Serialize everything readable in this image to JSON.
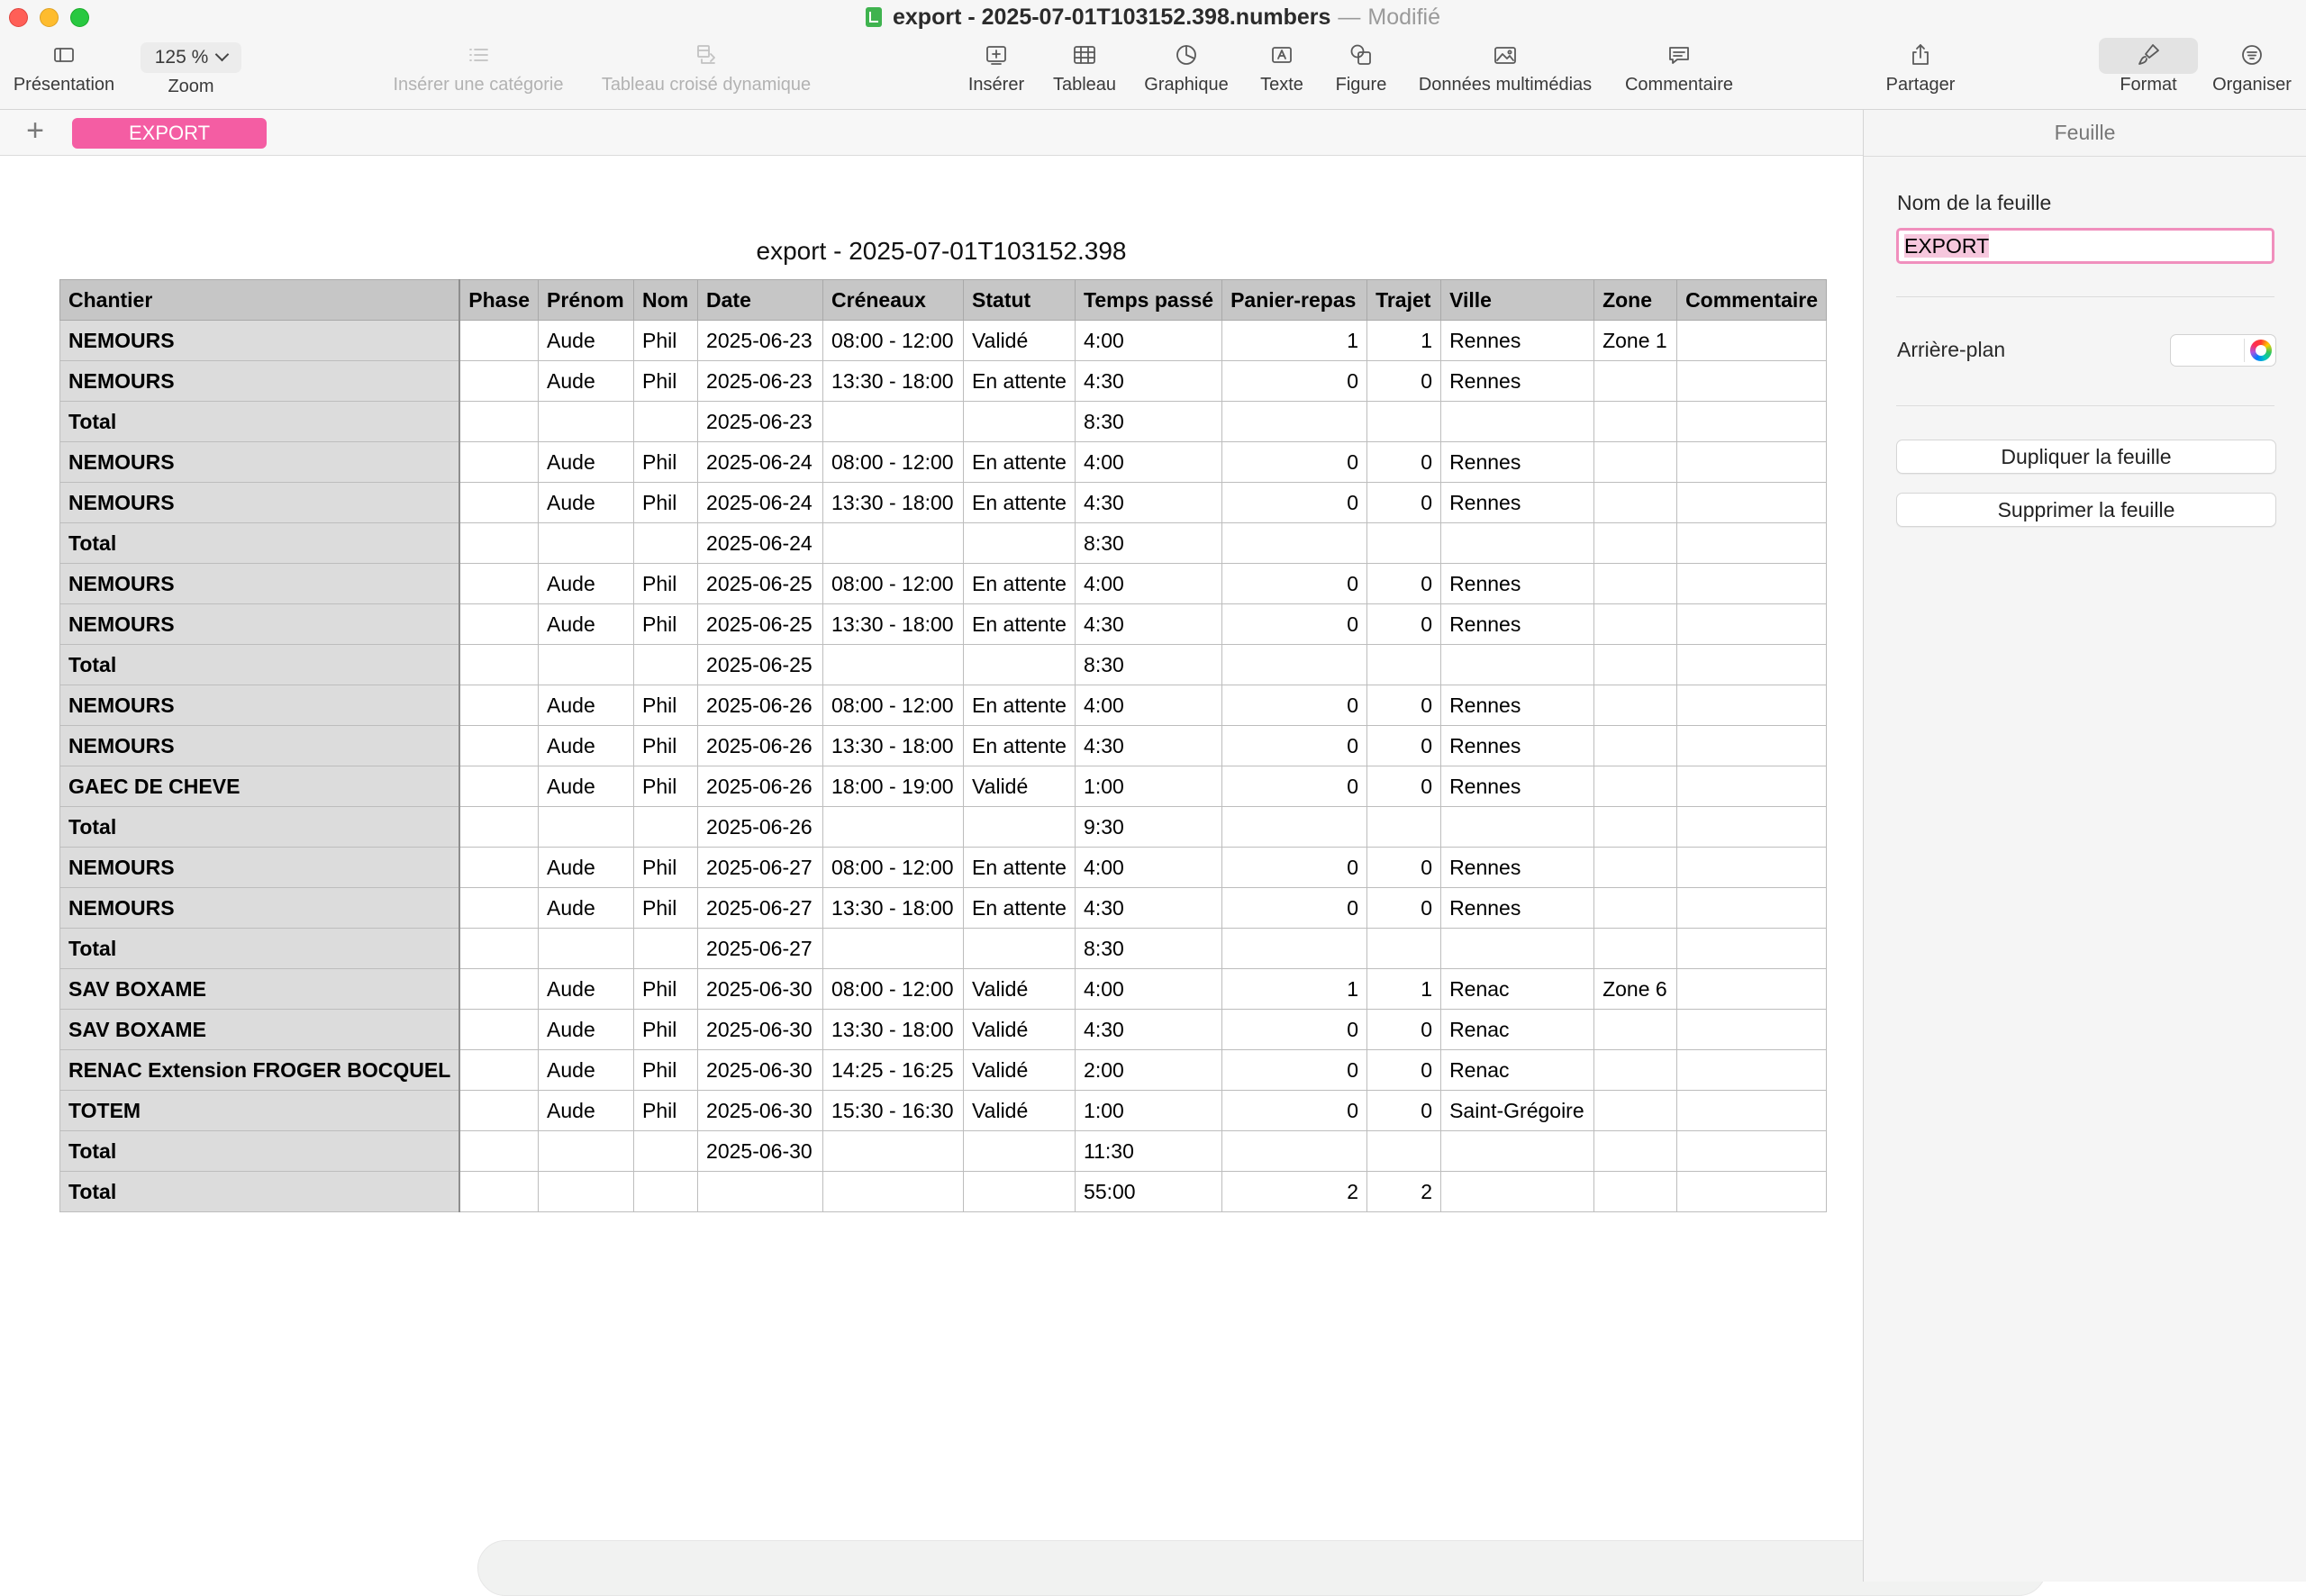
{
  "window": {
    "title": "export - 2025-07-01T103152.398.numbers",
    "separator": "—",
    "state": "Modifié"
  },
  "toolbar": {
    "presentation": "Présentation",
    "zoom_value": "125 %",
    "zoom": "Zoom",
    "insert_category": "Insérer une catégorie",
    "pivot_table": "Tableau croisé dynamique",
    "insert": "Insérer",
    "table": "Tableau",
    "chart": "Graphique",
    "text": "Texte",
    "shape": "Figure",
    "media": "Données multimédias",
    "comment": "Commentaire",
    "share": "Partager",
    "format": "Format",
    "organize": "Organiser"
  },
  "tabs": {
    "add": "+",
    "sheet": "EXPORT"
  },
  "table": {
    "title": "export - 2025-07-01T103152.398",
    "columns": [
      "Chantier",
      "Phase",
      "Prénom",
      "Nom",
      "Date",
      "Créneaux",
      "Statut",
      "Temps passé",
      "Panier-repas",
      "Trajet",
      "Ville",
      "Zone",
      "Commentaire"
    ],
    "rows": [
      [
        "NEMOURS",
        "",
        "Aude",
        "Phil",
        "2025-06-23",
        "08:00 - 12:00",
        "Validé",
        "4:00",
        "1",
        "1",
        "Rennes",
        "Zone 1",
        ""
      ],
      [
        "NEMOURS",
        "",
        "Aude",
        "Phil",
        "2025-06-23",
        "13:30 - 18:00",
        "En attente",
        "4:30",
        "0",
        "0",
        "Rennes",
        "",
        ""
      ],
      [
        "Total",
        "",
        "",
        "",
        "2025-06-23",
        "",
        "",
        "8:30",
        "",
        "",
        "",
        "",
        ""
      ],
      [
        "NEMOURS",
        "",
        "Aude",
        "Phil",
        "2025-06-24",
        "08:00 - 12:00",
        "En attente",
        "4:00",
        "0",
        "0",
        "Rennes",
        "",
        ""
      ],
      [
        "NEMOURS",
        "",
        "Aude",
        "Phil",
        "2025-06-24",
        "13:30 - 18:00",
        "En attente",
        "4:30",
        "0",
        "0",
        "Rennes",
        "",
        ""
      ],
      [
        "Total",
        "",
        "",
        "",
        "2025-06-24",
        "",
        "",
        "8:30",
        "",
        "",
        "",
        "",
        ""
      ],
      [
        "NEMOURS",
        "",
        "Aude",
        "Phil",
        "2025-06-25",
        "08:00 - 12:00",
        "En attente",
        "4:00",
        "0",
        "0",
        "Rennes",
        "",
        ""
      ],
      [
        "NEMOURS",
        "",
        "Aude",
        "Phil",
        "2025-06-25",
        "13:30 - 18:00",
        "En attente",
        "4:30",
        "0",
        "0",
        "Rennes",
        "",
        ""
      ],
      [
        "Total",
        "",
        "",
        "",
        "2025-06-25",
        "",
        "",
        "8:30",
        "",
        "",
        "",
        "",
        ""
      ],
      [
        "NEMOURS",
        "",
        "Aude",
        "Phil",
        "2025-06-26",
        "08:00 - 12:00",
        "En attente",
        "4:00",
        "0",
        "0",
        "Rennes",
        "",
        ""
      ],
      [
        "NEMOURS",
        "",
        "Aude",
        "Phil",
        "2025-06-26",
        "13:30 - 18:00",
        "En attente",
        "4:30",
        "0",
        "0",
        "Rennes",
        "",
        ""
      ],
      [
        "GAEC DE CHEVE",
        "",
        "Aude",
        "Phil",
        "2025-06-26",
        "18:00 - 19:00",
        "Validé",
        "1:00",
        "0",
        "0",
        "Rennes",
        "",
        ""
      ],
      [
        "Total",
        "",
        "",
        "",
        "2025-06-26",
        "",
        "",
        "9:30",
        "",
        "",
        "",
        "",
        ""
      ],
      [
        "NEMOURS",
        "",
        "Aude",
        "Phil",
        "2025-06-27",
        "08:00 - 12:00",
        "En attente",
        "4:00",
        "0",
        "0",
        "Rennes",
        "",
        ""
      ],
      [
        "NEMOURS",
        "",
        "Aude",
        "Phil",
        "2025-06-27",
        "13:30 - 18:00",
        "En attente",
        "4:30",
        "0",
        "0",
        "Rennes",
        "",
        ""
      ],
      [
        "Total",
        "",
        "",
        "",
        "2025-06-27",
        "",
        "",
        "8:30",
        "",
        "",
        "",
        "",
        ""
      ],
      [
        "SAV BOXAME",
        "",
        "Aude",
        "Phil",
        "2025-06-30",
        "08:00 - 12:00",
        "Validé",
        "4:00",
        "1",
        "1",
        "Renac",
        "Zone 6",
        ""
      ],
      [
        "SAV BOXAME",
        "",
        "Aude",
        "Phil",
        "2025-06-30",
        "13:30 - 18:00",
        "Validé",
        "4:30",
        "0",
        "0",
        "Renac",
        "",
        ""
      ],
      [
        "RENAC Extension FROGER BOCQUEL",
        "",
        "Aude",
        "Phil",
        "2025-06-30",
        "14:25 - 16:25",
        "Validé",
        "2:00",
        "0",
        "0",
        "Renac",
        "",
        ""
      ],
      [
        "TOTEM",
        "",
        "Aude",
        "Phil",
        "2025-06-30",
        "15:30 - 16:30",
        "Validé",
        "1:00",
        "0",
        "0",
        "Saint-Grégoire",
        "",
        ""
      ],
      [
        "Total",
        "",
        "",
        "",
        "2025-06-30",
        "",
        "",
        "11:30",
        "",
        "",
        "",
        "",
        ""
      ],
      [
        "Total",
        "",
        "",
        "",
        "",
        "",
        "",
        "55:00",
        "2",
        "2",
        "",
        "",
        ""
      ]
    ]
  },
  "inspector": {
    "header": "Feuille",
    "sheet_name_label": "Nom de la feuille",
    "sheet_name_value": "EXPORT",
    "background_label": "Arrière-plan",
    "duplicate": "Dupliquer la feuille",
    "delete": "Supprimer la feuille"
  },
  "colors": {
    "tab_accent": "#f45da3",
    "header_fill": "#c6c6c6",
    "first_column_fill": "#dcdcdc"
  }
}
